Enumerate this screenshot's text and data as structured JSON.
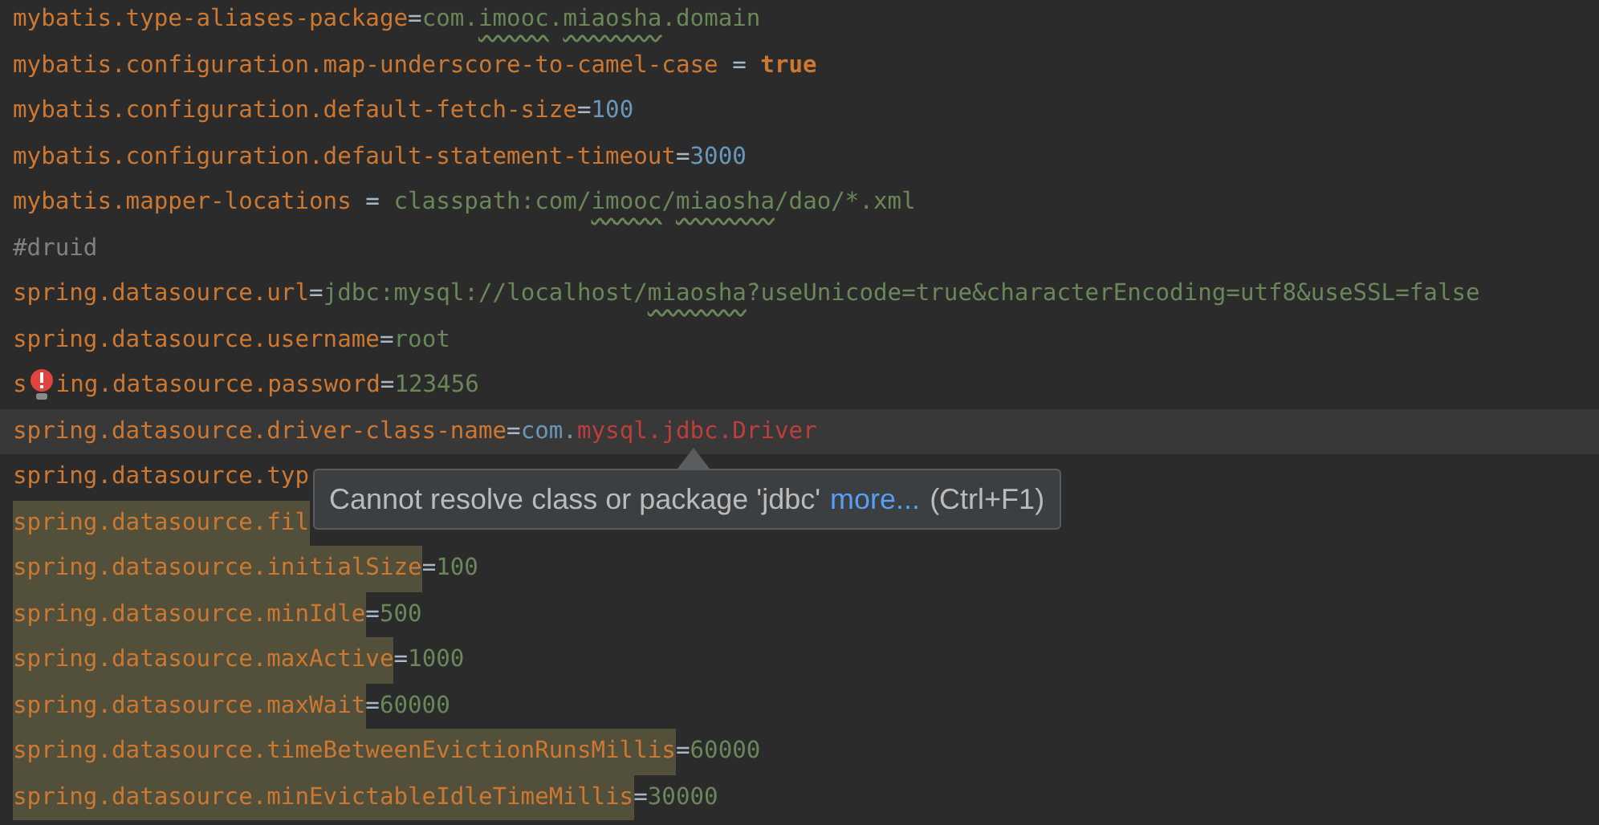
{
  "editor": {
    "lines": [
      {
        "current": false,
        "highlighted": false,
        "segments": [
          {
            "text": "mybatis.type-aliases-package",
            "kind": "key"
          },
          {
            "text": "=",
            "kind": "op"
          },
          {
            "text": "com.",
            "kind": "value"
          },
          {
            "text": "imooc",
            "kind": "value",
            "typo": true
          },
          {
            "text": ".",
            "kind": "value"
          },
          {
            "text": "miaosha",
            "kind": "value",
            "typo": true
          },
          {
            "text": ".domain",
            "kind": "value"
          }
        ]
      },
      {
        "current": false,
        "highlighted": false,
        "segments": [
          {
            "text": "mybatis.configuration.map-underscore-to-camel-case",
            "kind": "key"
          },
          {
            "text": " = ",
            "kind": "op"
          },
          {
            "text": "true",
            "kind": "keyword"
          }
        ]
      },
      {
        "current": false,
        "highlighted": false,
        "segments": [
          {
            "text": "mybatis.configuration.default-fetch-size",
            "kind": "key"
          },
          {
            "text": "=",
            "kind": "op"
          },
          {
            "text": "100",
            "kind": "number"
          }
        ]
      },
      {
        "current": false,
        "highlighted": false,
        "segments": [
          {
            "text": "mybatis.configuration.default-statement-timeout",
            "kind": "key"
          },
          {
            "text": "=",
            "kind": "op"
          },
          {
            "text": "3000",
            "kind": "number"
          }
        ]
      },
      {
        "current": false,
        "highlighted": false,
        "segments": [
          {
            "text": "mybatis.mapper-locations",
            "kind": "key"
          },
          {
            "text": " = ",
            "kind": "op"
          },
          {
            "text": "classpath:com/",
            "kind": "value"
          },
          {
            "text": "imooc",
            "kind": "value",
            "typo": true
          },
          {
            "text": "/",
            "kind": "value"
          },
          {
            "text": "miaosha",
            "kind": "value",
            "typo": true
          },
          {
            "text": "/dao/*.xml",
            "kind": "value"
          }
        ]
      },
      {
        "current": false,
        "highlighted": false,
        "segments": [
          {
            "text": "#druid",
            "kind": "comment"
          }
        ]
      },
      {
        "current": false,
        "highlighted": false,
        "segments": [
          {
            "text": "spring.datasource.url",
            "kind": "key"
          },
          {
            "text": "=",
            "kind": "op"
          },
          {
            "text": "jdbc:mysql://localhost/",
            "kind": "value"
          },
          {
            "text": "miaosha",
            "kind": "value",
            "typo": true
          },
          {
            "text": "?useUnicode=true&characterEncoding=utf8&useSSL=false",
            "kind": "value"
          }
        ]
      },
      {
        "current": false,
        "highlighted": false,
        "segments": [
          {
            "text": "spring.datasource.username",
            "kind": "key"
          },
          {
            "text": "=",
            "kind": "op"
          },
          {
            "text": "root",
            "kind": "value"
          }
        ]
      },
      {
        "current": false,
        "highlighted": false,
        "segments": [
          {
            "text": "s",
            "kind": "key"
          },
          {
            "kind": "bulb"
          },
          {
            "text": "ing.datasource.password",
            "kind": "key"
          },
          {
            "text": "=",
            "kind": "op"
          },
          {
            "text": "123456",
            "kind": "value"
          }
        ]
      },
      {
        "current": true,
        "highlighted": false,
        "segments": [
          {
            "text": "spring.datasource.driver-class-name",
            "kind": "key"
          },
          {
            "text": "=",
            "kind": "op"
          },
          {
            "text": "com.",
            "kind": "number"
          },
          {
            "text": "mysql.",
            "kind": "error"
          },
          {
            "text": "jdbc",
            "kind": "error"
          },
          {
            "text": ".Driver",
            "kind": "error"
          }
        ]
      },
      {
        "current": false,
        "highlighted": false,
        "segments": [
          {
            "text": "spring.datasource.typ",
            "kind": "key"
          }
        ]
      },
      {
        "current": false,
        "highlighted": true,
        "segments": [
          {
            "text": "spring.datasource.fil",
            "kind": "key"
          }
        ]
      },
      {
        "current": false,
        "highlighted": true,
        "segments": [
          {
            "text": "spring.datasource.initialSize",
            "kind": "key"
          },
          {
            "text": "=",
            "kind": "op"
          },
          {
            "text": "100",
            "kind": "value"
          }
        ]
      },
      {
        "current": false,
        "highlighted": true,
        "segments": [
          {
            "text": "spring.datasource.minIdle",
            "kind": "key"
          },
          {
            "text": "=",
            "kind": "op"
          },
          {
            "text": "500",
            "kind": "value"
          }
        ]
      },
      {
        "current": false,
        "highlighted": true,
        "segments": [
          {
            "text": "spring.datasource.maxActive",
            "kind": "key"
          },
          {
            "text": "=",
            "kind": "op"
          },
          {
            "text": "1000",
            "kind": "value"
          }
        ]
      },
      {
        "current": false,
        "highlighted": true,
        "segments": [
          {
            "text": "spring.datasource.maxWait",
            "kind": "key"
          },
          {
            "text": "=",
            "kind": "op"
          },
          {
            "text": "60000",
            "kind": "value"
          }
        ]
      },
      {
        "current": false,
        "highlighted": true,
        "segments": [
          {
            "text": "spring.datasource.timeBetweenEvictionRunsMillis",
            "kind": "key"
          },
          {
            "text": "=",
            "kind": "op"
          },
          {
            "text": "60000",
            "kind": "value"
          }
        ]
      },
      {
        "current": false,
        "highlighted": true,
        "segments": [
          {
            "text": "spring.datasource.minEvictableIdleTimeMillis",
            "kind": "key"
          },
          {
            "text": "=",
            "kind": "op"
          },
          {
            "text": "30000",
            "kind": "value"
          }
        ]
      }
    ]
  },
  "tooltip": {
    "message": "Cannot resolve class or package 'jdbc'",
    "link": "more...",
    "shortcut": "(Ctrl+F1)"
  }
}
